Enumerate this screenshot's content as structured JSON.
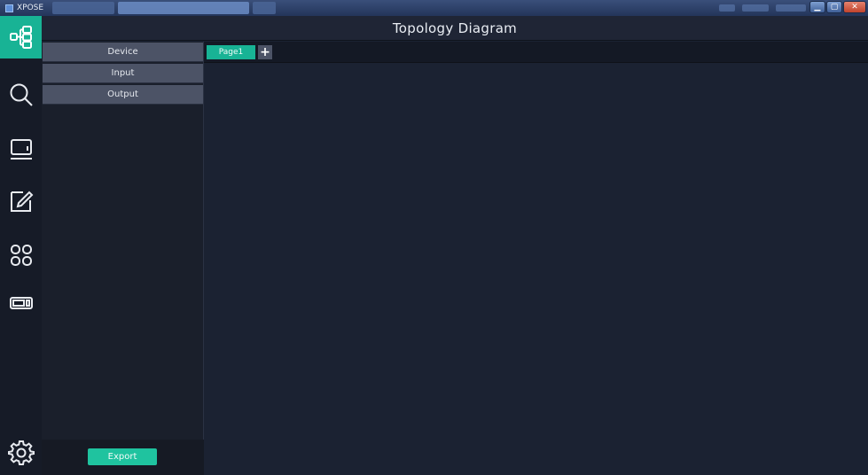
{
  "os_window": {
    "app_label": "XPOSE"
  },
  "header": {
    "title": "Topology Diagram"
  },
  "rail": {
    "items": [
      {
        "icon": "topology-icon",
        "active": true
      },
      {
        "icon": "search-icon",
        "active": false
      },
      {
        "icon": "monitor-icon",
        "active": false
      },
      {
        "icon": "edit-icon",
        "active": false
      },
      {
        "icon": "grid-apps-icon",
        "active": false
      },
      {
        "icon": "display-device-icon",
        "active": false
      },
      {
        "icon": "gear-icon",
        "active": false
      }
    ],
    "accent_color": "#18b395"
  },
  "side_panel": {
    "items": [
      {
        "label": "Device"
      },
      {
        "label": "Input"
      },
      {
        "label": "Output"
      }
    ],
    "export_label": "Export"
  },
  "canvas": {
    "tabs": [
      {
        "label": "Page1",
        "active": true
      }
    ],
    "add_tab_label": "+"
  }
}
